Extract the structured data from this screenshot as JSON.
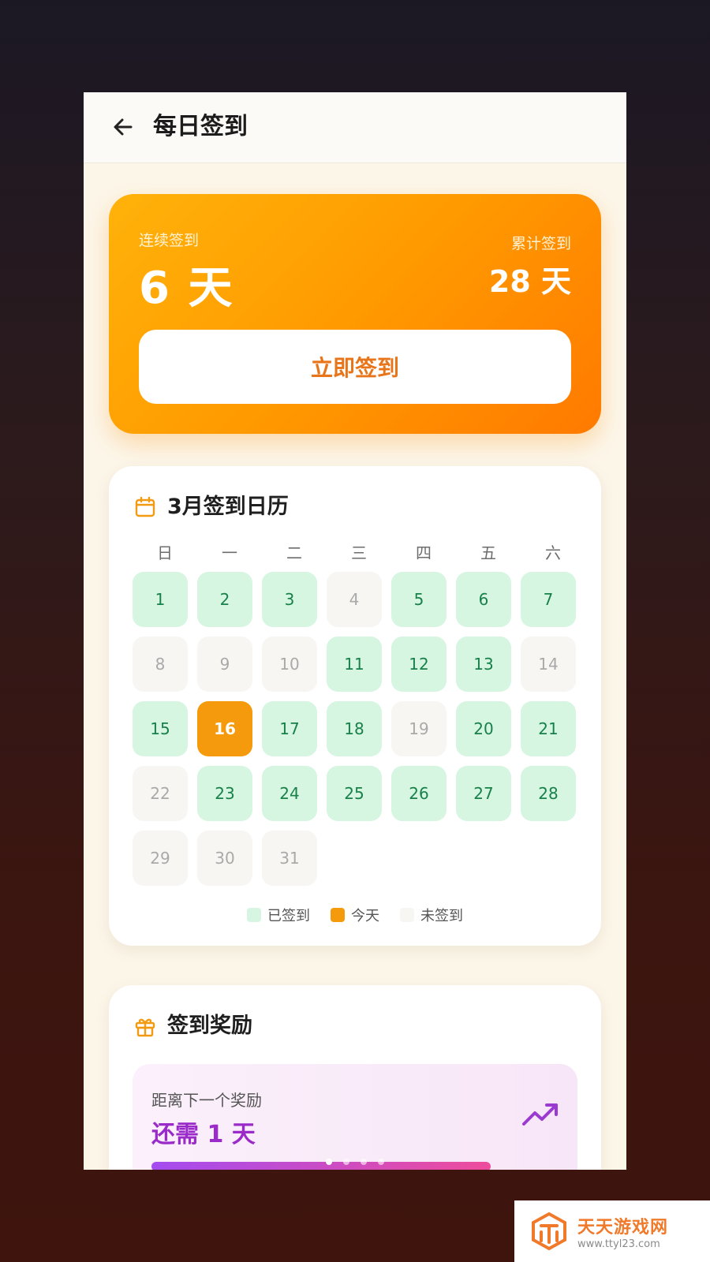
{
  "header": {
    "title": "每日签到"
  },
  "hero": {
    "consecutive_label": "连续签到",
    "consecutive_value": "6 天",
    "total_label": "累计签到",
    "total_value": "28 天",
    "button_label": "立即签到"
  },
  "calendar": {
    "title": "3月签到日历",
    "weekdays": [
      "日",
      "一",
      "二",
      "三",
      "四",
      "五",
      "六"
    ],
    "days": [
      {
        "d": "1",
        "s": "done"
      },
      {
        "d": "2",
        "s": "done"
      },
      {
        "d": "3",
        "s": "done"
      },
      {
        "d": "4",
        "s": "miss"
      },
      {
        "d": "5",
        "s": "done"
      },
      {
        "d": "6",
        "s": "done"
      },
      {
        "d": "7",
        "s": "done"
      },
      {
        "d": "8",
        "s": "miss"
      },
      {
        "d": "9",
        "s": "miss"
      },
      {
        "d": "10",
        "s": "miss"
      },
      {
        "d": "11",
        "s": "done"
      },
      {
        "d": "12",
        "s": "done"
      },
      {
        "d": "13",
        "s": "done"
      },
      {
        "d": "14",
        "s": "miss"
      },
      {
        "d": "15",
        "s": "done"
      },
      {
        "d": "16",
        "s": "today"
      },
      {
        "d": "17",
        "s": "done"
      },
      {
        "d": "18",
        "s": "done"
      },
      {
        "d": "19",
        "s": "miss"
      },
      {
        "d": "20",
        "s": "done"
      },
      {
        "d": "21",
        "s": "done"
      },
      {
        "d": "22",
        "s": "miss"
      },
      {
        "d": "23",
        "s": "done"
      },
      {
        "d": "24",
        "s": "done"
      },
      {
        "d": "25",
        "s": "done"
      },
      {
        "d": "26",
        "s": "done"
      },
      {
        "d": "27",
        "s": "done"
      },
      {
        "d": "28",
        "s": "done"
      },
      {
        "d": "29",
        "s": "miss"
      },
      {
        "d": "30",
        "s": "miss"
      },
      {
        "d": "31",
        "s": "miss"
      }
    ],
    "legend": {
      "done": "已签到",
      "today": "今天",
      "miss": "未签到"
    }
  },
  "reward": {
    "title": "签到奖励",
    "hint": "距离下一个奖励",
    "remain": "还需 1 天"
  },
  "pager": {
    "count": 4,
    "active": 0
  },
  "colors": {
    "accent": "#ff9a00",
    "done_bg": "#d6f6e2",
    "done_text": "#18814a",
    "today_bg": "#f59a0c",
    "reward_text": "#9a2bc9"
  },
  "watermark": {
    "title": "天天游戏网",
    "url": "www.ttyl23.com"
  }
}
